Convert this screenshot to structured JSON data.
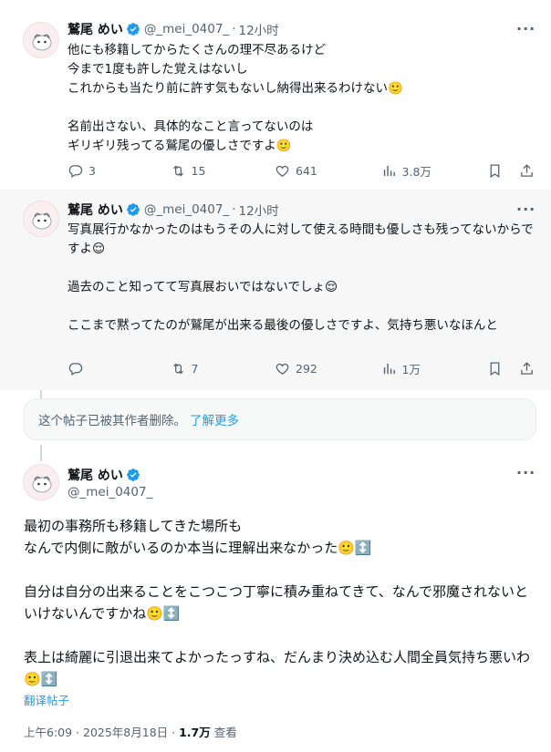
{
  "tweets": [
    {
      "name": "鷲尾 めい",
      "handle": "@_mei_0407_",
      "time": "12小时",
      "text": "他にも移籍してからたくさんの理不尽あるけど\n今まで1度も許した覚えはないし\nこれからも当たり前に許す気もないし納得出来るわけない🙂\n\n名前出さない、具体的なこと言ってないのは\nギリギリ残ってる鷲尾の優しさですよ🙂",
      "replies": "3",
      "reposts": "15",
      "likes": "641",
      "views": "3.8万"
    },
    {
      "name": "鷲尾 めい",
      "handle": "@_mei_0407_",
      "time": "12小时",
      "text": "写真展行かなかったのはもうその人に対して使える時間も優しさも残ってないからですよ😌\n\n過去のこと知ってて写真展おいではないでしょ😌\n\nここまで黙ってたのが鷲尾が出来る最後の優しさですよ、気持ち悪いなほんと",
      "replies": "",
      "reposts": "7",
      "likes": "292",
      "views": "1万"
    }
  ],
  "deleted_notice": {
    "text": "这个帖子已被其作者删除。",
    "link": "了解更多"
  },
  "main_tweet": {
    "name": "鷲尾 めい",
    "handle": "@_mei_0407_",
    "text": "最初の事務所も移籍してきた場所も\nなんで内側に敵がいるのか本当に理解出来なかった🙂↕️\n\n自分は自分の出来ることをこつこつ丁寧に積み重ねてきて、なんで邪魔されないといけないんですかね🙂↕️\n\n表上は綺麗に引退出来てよかったっすね、だんまり決め込む人間全員気持ち悪いわ🙂↕️",
    "translate": "翻译帖子",
    "timestamp": "上午6:09 · 2025年8月18日 · ",
    "views": "1.7万",
    "views_label": " 查看"
  },
  "colors": {
    "accent": "#1d9bf0",
    "verified": "#1d9bf0",
    "muted": "#536471",
    "highlight_bg": "#f7f7f7"
  },
  "icons": [
    "avatar-image",
    "verified-badge-icon",
    "more-icon",
    "reply-icon",
    "repost-icon",
    "like-icon",
    "views-icon",
    "bookmark-icon",
    "share-icon"
  ]
}
